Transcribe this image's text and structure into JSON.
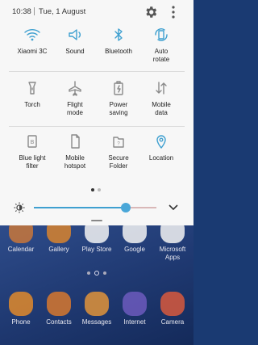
{
  "status_bar": {
    "time": "10:38",
    "date": "Tue, 1 August"
  },
  "quick_settings": [
    {
      "label": "Xiaomi 3C",
      "icon": "wifi-icon",
      "active": true
    },
    {
      "label": "Sound",
      "icon": "volume-icon",
      "active": true
    },
    {
      "label": "Bluetooth",
      "icon": "bluetooth-icon",
      "active": true
    },
    {
      "label": "Auto\nrotate",
      "icon": "auto-rotate-icon",
      "active": true
    },
    {
      "label": "Torch",
      "icon": "torch-icon",
      "active": false
    },
    {
      "label": "Flight\nmode",
      "icon": "airplane-icon",
      "active": false
    },
    {
      "label": "Power\nsaving",
      "icon": "battery-icon",
      "active": false
    },
    {
      "label": "Mobile\ndata",
      "icon": "mobile-data-icon",
      "active": false
    },
    {
      "label": "Blue light\nfilter",
      "icon": "blue-light-icon",
      "active": false
    },
    {
      "label": "Mobile\nhotspot",
      "icon": "hotspot-icon",
      "active": false
    },
    {
      "label": "Secure\nFolder",
      "icon": "secure-folder-icon",
      "active": false
    },
    {
      "label": "Location",
      "icon": "location-icon",
      "active": true
    }
  ],
  "brightness": {
    "level": 0.75
  },
  "pager": {
    "pages": 2,
    "current": 0
  },
  "home_apps_row1": [
    "Calendar",
    "Gallery",
    "Play Store",
    "Google",
    "Microsoft\nApps"
  ],
  "home_apps_row2": [
    "Phone",
    "Contacts",
    "Messages",
    "Internet",
    "Camera"
  ],
  "colors": {
    "accent": "#3fa0d0",
    "inactive": "#8a8a8a",
    "panel": "#f7f7f7"
  }
}
